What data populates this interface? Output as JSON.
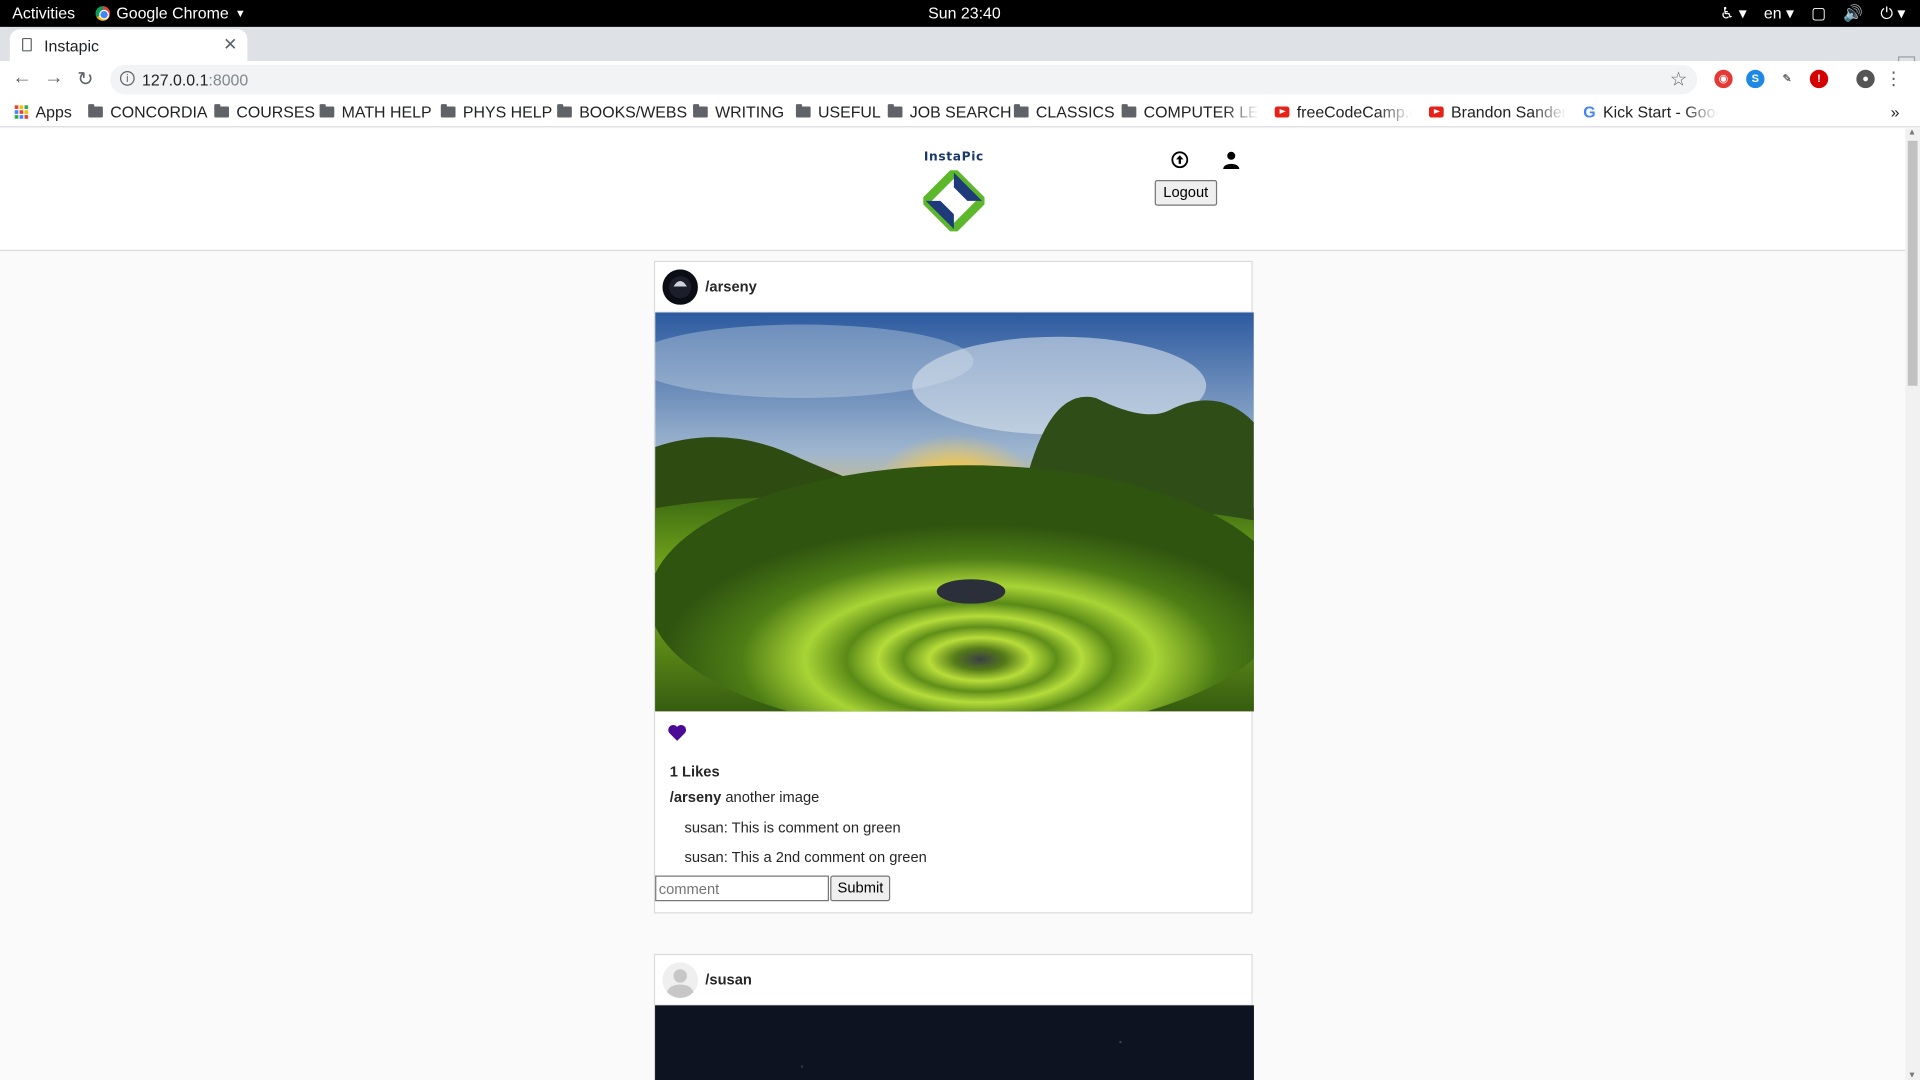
{
  "system_bar": {
    "activities": "Activities",
    "app_name": "Google Chrome",
    "clock": "Sun 23:40",
    "language": "en"
  },
  "browser": {
    "tab_title": "Instapic",
    "url_host": "127.0.0.1",
    "url_port": ":8000",
    "bookmarks": [
      {
        "label": "Apps",
        "icon": "apps-grid-icon"
      },
      {
        "label": "CONCORDIA",
        "icon": "folder-icon"
      },
      {
        "label": "COURSES",
        "icon": "folder-icon"
      },
      {
        "label": "MATH HELP",
        "icon": "folder-icon"
      },
      {
        "label": "PHYS HELP",
        "icon": "folder-icon"
      },
      {
        "label": "BOOKS/WEBS",
        "icon": "folder-icon"
      },
      {
        "label": "WRITING",
        "icon": "folder-icon"
      },
      {
        "label": "USEFUL",
        "icon": "folder-icon"
      },
      {
        "label": "JOB SEARCH",
        "icon": "folder-icon"
      },
      {
        "label": "CLASSICS",
        "icon": "folder-icon"
      },
      {
        "label": "COMPUTER LEAR",
        "icon": "folder-icon"
      },
      {
        "label": "freeCodeCamp.o",
        "icon": "youtube-icon"
      },
      {
        "label": "Brandon Sanders",
        "icon": "youtube-icon"
      },
      {
        "label": "Kick Start - Goog",
        "icon": "google-icon"
      }
    ],
    "overflow": "»"
  },
  "site": {
    "logo_text": "InstaPic",
    "logout_label": "Logout",
    "brand_colors": {
      "green": "#5cb82a",
      "navy": "#1e3a7b"
    }
  },
  "posts": [
    {
      "username": "/arseny",
      "likes_text": "1 Likes",
      "caption_user": "/arseny",
      "caption_text": "another image",
      "comments": [
        "susan: This is comment on green",
        "susan: This a 2nd comment on green"
      ],
      "comment_placeholder": "comment",
      "submit_label": "Submit",
      "liked": true,
      "heart_color": "#4b0a96"
    },
    {
      "username": "/susan"
    }
  ]
}
